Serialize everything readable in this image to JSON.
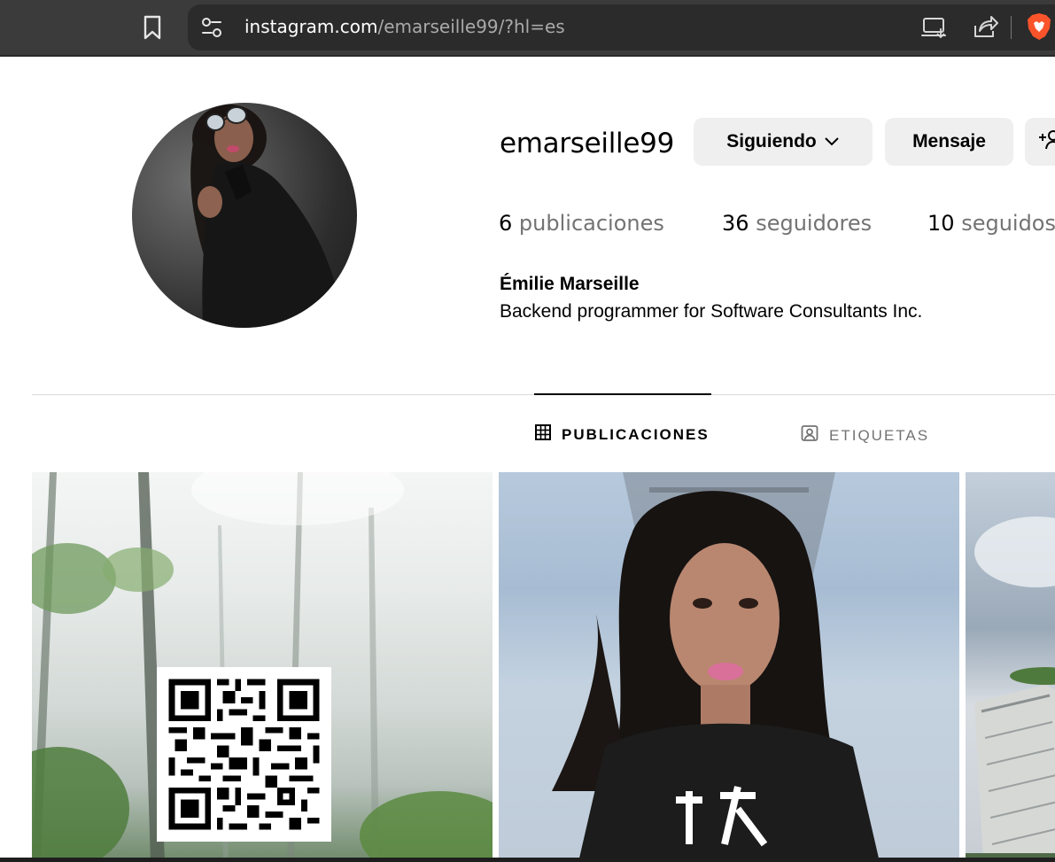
{
  "browser": {
    "url_host": "instagram.com",
    "url_path": "/emarseille99/?hl=es",
    "icons": [
      "bookmark-icon",
      "site-settings-icon",
      "cast-icon",
      "share-icon",
      "brave-shield-icon"
    ]
  },
  "profile": {
    "username": "emarseille99",
    "follow_button": "Siguiendo",
    "message_button": "Mensaje",
    "add_user_glyph": "+",
    "stats": {
      "posts_count": "6",
      "posts_label": "publicaciones",
      "followers_count": "36",
      "followers_label": "seguidores",
      "following_count": "10",
      "following_label": "seguidos"
    },
    "full_name": "Émilie Marseille",
    "bio": "Backend programmer for Software Consultants Inc."
  },
  "tabs": [
    {
      "label": "PUBLICACIONES",
      "icon": "grid-icon",
      "active": true
    },
    {
      "label": "ETIQUETAS",
      "icon": "tagged-user-icon",
      "active": false
    }
  ],
  "grid": {
    "posts": [
      {
        "subject": "misty forest with QR code"
      },
      {
        "subject": "woman with long dark hair"
      },
      {
        "subject": "city skyscraper"
      }
    ]
  },
  "colors": {
    "chrome_bg": "#3b3b3b",
    "url_bar_bg": "#2b2b2b",
    "button_bg": "#efefef",
    "muted_text": "#737373",
    "divider": "#dbdbdb",
    "brave_orange": "#fb542b"
  }
}
